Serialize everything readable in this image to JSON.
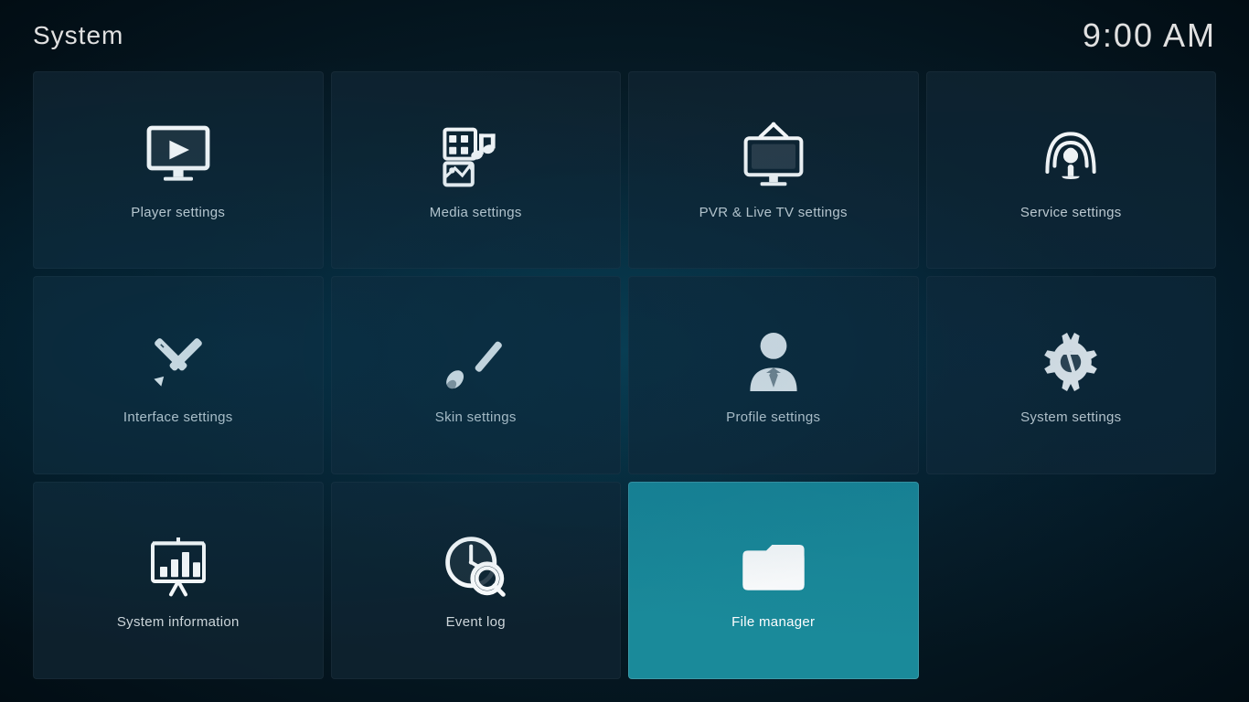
{
  "header": {
    "title": "System",
    "time": "9:00 AM"
  },
  "tiles": [
    {
      "id": "player-settings",
      "label": "Player settings",
      "icon": "player",
      "active": false
    },
    {
      "id": "media-settings",
      "label": "Media settings",
      "icon": "media",
      "active": false
    },
    {
      "id": "pvr-settings",
      "label": "PVR & Live TV settings",
      "icon": "pvr",
      "active": false
    },
    {
      "id": "service-settings",
      "label": "Service settings",
      "icon": "service",
      "active": false
    },
    {
      "id": "interface-settings",
      "label": "Interface settings",
      "icon": "interface",
      "active": false
    },
    {
      "id": "skin-settings",
      "label": "Skin settings",
      "icon": "skin",
      "active": false
    },
    {
      "id": "profile-settings",
      "label": "Profile settings",
      "icon": "profile",
      "active": false
    },
    {
      "id": "system-settings",
      "label": "System settings",
      "icon": "system",
      "active": false
    },
    {
      "id": "system-information",
      "label": "System information",
      "icon": "sysinfo",
      "active": false
    },
    {
      "id": "event-log",
      "label": "Event log",
      "icon": "eventlog",
      "active": false
    },
    {
      "id": "file-manager",
      "label": "File manager",
      "icon": "filemanager",
      "active": true
    }
  ]
}
